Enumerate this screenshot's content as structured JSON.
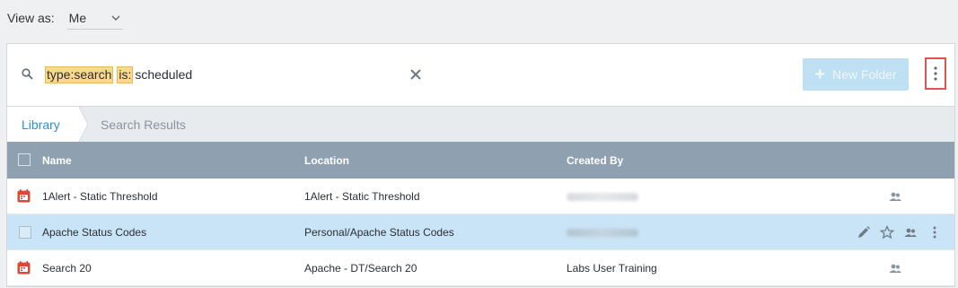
{
  "view_as": {
    "label": "View as:",
    "value": "Me"
  },
  "search": {
    "tokens": [
      "type:search",
      "is:"
    ],
    "text": "scheduled",
    "new_folder_label": "New Folder"
  },
  "tabs": {
    "library": "Library",
    "results": "Search Results"
  },
  "table": {
    "headers": {
      "name": "Name",
      "location": "Location",
      "created_by": "Created By"
    },
    "rows": [
      {
        "name": "1Alert - Static Threshold",
        "location": "1Alert - Static Threshold",
        "created_by": "",
        "icon": "calendar-icon"
      },
      {
        "name": "Apache Status Codes",
        "location": "Personal/Apache Status Codes",
        "created_by": "",
        "selected": true
      },
      {
        "name": "Search 20",
        "location": "Apache - DT/Search 20",
        "created_by": "Labs User Training",
        "icon": "calendar-icon"
      }
    ]
  },
  "colors": {
    "accent": "#2d8fd5",
    "header_bg": "#8fa0b1",
    "selected_row": "#c9e4f6",
    "highlight": "#fbd98c",
    "alert_red": "#e0453a"
  }
}
